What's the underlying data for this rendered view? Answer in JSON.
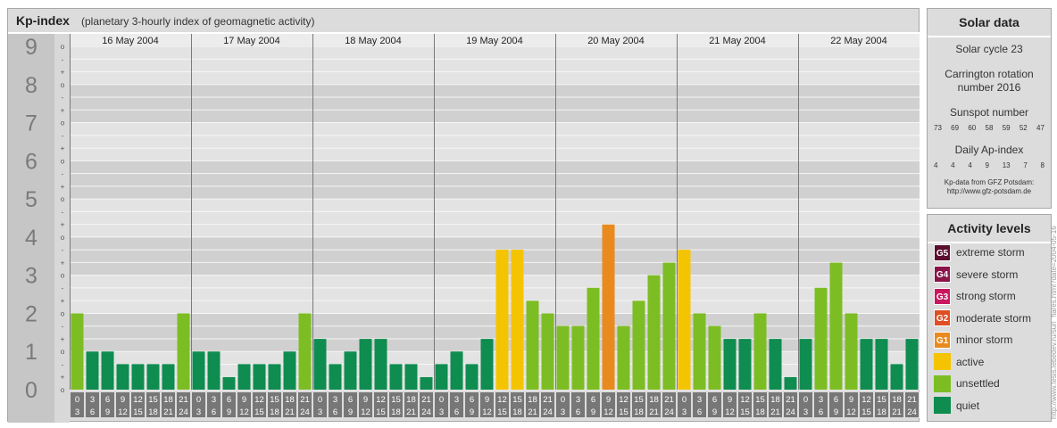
{
  "header": {
    "title": "Kp-index",
    "subtitle": "(planetary 3-hourly index of geomagnetic activity)"
  },
  "chart_data": {
    "type": "bar",
    "y_labels": [
      "0",
      "1",
      "2",
      "3",
      "4",
      "5",
      "6",
      "7",
      "8",
      "9"
    ],
    "minor_labels": [
      "o",
      "+",
      "-"
    ],
    "days": [
      "16 May 2004",
      "17 May 2004",
      "18 May 2004",
      "19 May 2004",
      "20 May 2004",
      "21 May 2004",
      "22 May 2004"
    ],
    "interval_top": [
      "0",
      "3",
      "6",
      "9",
      "12",
      "15",
      "18",
      "21"
    ],
    "interval_bottom": [
      "3",
      "6",
      "9",
      "12",
      "15",
      "18",
      "21",
      "24"
    ],
    "ylim": [
      0,
      9
    ],
    "values": [
      2.0,
      1.0,
      1.0,
      0.67,
      0.67,
      0.67,
      0.67,
      2.0,
      1.0,
      1.0,
      0.33,
      0.67,
      0.67,
      0.67,
      1.0,
      2.0,
      1.33,
      0.67,
      1.0,
      1.33,
      1.33,
      0.67,
      0.67,
      0.33,
      0.67,
      1.0,
      0.67,
      1.33,
      3.67,
      3.67,
      2.33,
      2.0,
      1.67,
      1.67,
      2.67,
      4.33,
      1.67,
      2.33,
      3.0,
      3.33,
      3.67,
      2.0,
      1.67,
      1.33,
      1.33,
      2.0,
      1.33,
      0.33,
      1.33,
      2.67,
      3.33,
      2.0,
      1.33,
      1.33,
      0.67,
      1.33
    ],
    "colors": {
      "quiet": "#0f8c4f",
      "unsettled": "#7dbd24",
      "active": "#f5c400"
    }
  },
  "solar": {
    "title": "Solar data",
    "cycle": "Solar cycle 23",
    "carrington": "Carrington rotation number 2016",
    "sunspot_label": "Sunspot number",
    "sunspots": [
      "73",
      "69",
      "60",
      "58",
      "59",
      "52",
      "47"
    ],
    "ap_label": "Daily Ap-index",
    "ap": [
      "4",
      "4",
      "4",
      "9",
      "13",
      "7",
      "8"
    ],
    "source_line1": "Kp-data from GFZ Potsdam:",
    "source_line2": "http://www.gfz-potsdam.de"
  },
  "activity": {
    "title": "Activity levels",
    "items": [
      {
        "code": "G5",
        "label": "extreme storm",
        "color": "#5a0f2e"
      },
      {
        "code": "G4",
        "label": "severe storm",
        "color": "#8a1448"
      },
      {
        "code": "G3",
        "label": "strong storm",
        "color": "#c9175f"
      },
      {
        "code": "G2",
        "label": "moderate storm",
        "color": "#e04e23"
      },
      {
        "code": "G1",
        "label": "minor storm",
        "color": "#e98a1e"
      },
      {
        "code": "",
        "label": "active",
        "color": "#f5c400"
      },
      {
        "code": "",
        "label": "unsettled",
        "color": "#7dbd24"
      },
      {
        "code": "",
        "label": "quiet",
        "color": "#0f8c4f"
      }
    ]
  },
  "watermark": "http://www.tesis.lebedev.ru/sun_flares.html?date=2004-05-16"
}
